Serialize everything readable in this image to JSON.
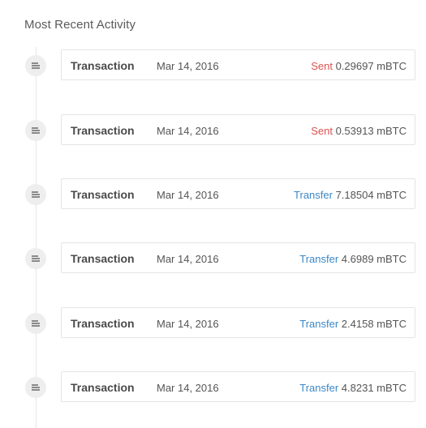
{
  "section": {
    "title": "Most Recent Activity"
  },
  "colors": {
    "sent": "#d9534f",
    "transfer": "#3b87c7"
  },
  "activities": [
    {
      "icon": "document-lines-icon",
      "type": "Transaction",
      "date": "Mar 14, 2016",
      "direction": "Sent",
      "direction_kind": "sent",
      "amount": "0.29697 mBTC"
    },
    {
      "icon": "document-lines-icon",
      "type": "Transaction",
      "date": "Mar 14, 2016",
      "direction": "Sent",
      "direction_kind": "sent",
      "amount": "0.53913 mBTC"
    },
    {
      "icon": "document-lines-icon",
      "type": "Transaction",
      "date": "Mar 14, 2016",
      "direction": "Transfer",
      "direction_kind": "transfer",
      "amount": "7.18504 mBTC"
    },
    {
      "icon": "document-lines-icon",
      "type": "Transaction",
      "date": "Mar 14, 2016",
      "direction": "Transfer",
      "direction_kind": "transfer",
      "amount": "4.6989 mBTC"
    },
    {
      "icon": "document-lines-icon",
      "type": "Transaction",
      "date": "Mar 14, 2016",
      "direction": "Transfer",
      "direction_kind": "transfer",
      "amount": "2.4158 mBTC"
    },
    {
      "icon": "document-lines-icon",
      "type": "Transaction",
      "date": "Mar 14, 2016",
      "direction": "Transfer",
      "direction_kind": "transfer",
      "amount": "4.8231 mBTC"
    }
  ]
}
